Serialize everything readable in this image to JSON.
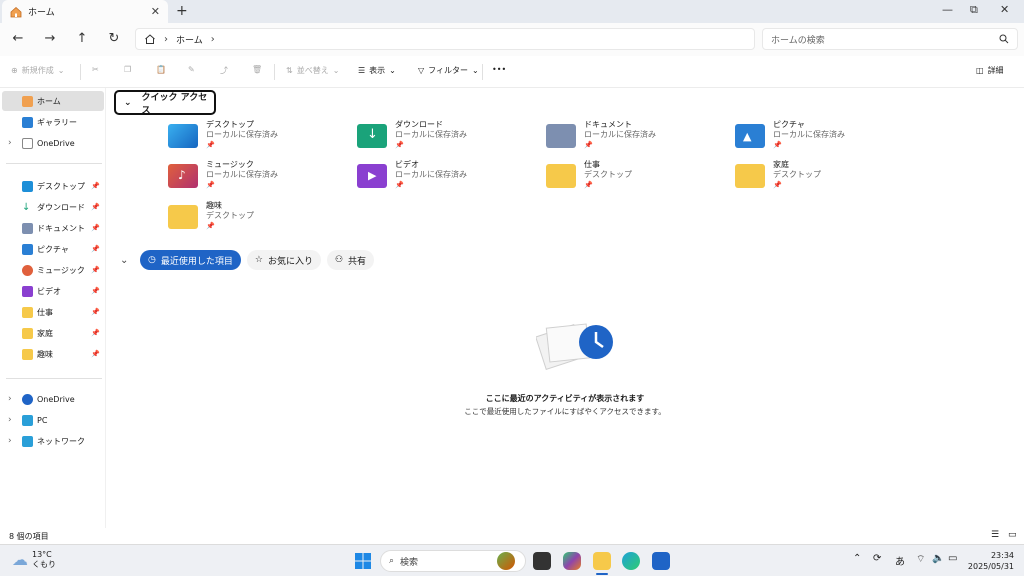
{
  "window": {
    "tab_title": "ホーム",
    "tab_close": "✕",
    "new_tab": "+",
    "controls": [
      "—",
      "⧉",
      "✕"
    ]
  },
  "address": {
    "crumb": "ホーム",
    "search_placeholder": "ホームの検索"
  },
  "toolbar": {
    "new_label": "新規作成",
    "sort_label": "並べ替え",
    "view_label": "表示",
    "filter_label": "フィルター",
    "more": "•••",
    "details_label": "詳細"
  },
  "sidebar": {
    "items": [
      {
        "label": "ホーム",
        "active": true
      },
      {
        "label": "ギャラリー"
      },
      {
        "label": "OneDrive"
      },
      {
        "label": "デスクトップ",
        "pinned": true
      },
      {
        "label": "ダウンロード",
        "pinned": true
      },
      {
        "label": "ドキュメント",
        "pinned": true
      },
      {
        "label": "ピクチャ",
        "pinned": true
      },
      {
        "label": "ミュージック",
        "pinned": true
      },
      {
        "label": "ビデオ",
        "pinned": true
      },
      {
        "label": "仕事",
        "pinned": true
      },
      {
        "label": "家庭",
        "pinned": true
      },
      {
        "label": "趣味",
        "pinned": true
      },
      {
        "label": "OneDrive"
      },
      {
        "label": "PC"
      },
      {
        "label": "ネットワーク"
      }
    ]
  },
  "quick_access": {
    "header": "クイック アクセス",
    "folders": [
      {
        "name": "デスクトップ",
        "location": "ローカルに保存済み",
        "color": "#1e8fd8"
      },
      {
        "name": "ダウンロード",
        "location": "ローカルに保存済み",
        "color": "#1aa37a"
      },
      {
        "name": "ドキュメント",
        "location": "ローカルに保存済み",
        "color": "#7d8fb0"
      },
      {
        "name": "ピクチャ",
        "location": "ローカルに保存済み",
        "color": "#2a7fd4"
      },
      {
        "name": "ミュージック",
        "location": "ローカルに保存済み",
        "color": "#e0603c"
      },
      {
        "name": "ビデオ",
        "location": "ローカルに保存済み",
        "color": "#8a3fd0"
      },
      {
        "name": "仕事",
        "location": "デスクトップ",
        "color": "#f6c94a"
      },
      {
        "name": "家庭",
        "location": "デスクトップ",
        "color": "#f6c94a"
      },
      {
        "name": "趣味",
        "location": "デスクトップ",
        "color": "#f6c94a"
      }
    ]
  },
  "recent": {
    "tabs": [
      "最近使用した項目",
      "お気に入り",
      "共有"
    ],
    "empty_title": "ここに最近のアクティビティが表示されます",
    "empty_sub": "ここで最近使用したファイルにすばやくアクセスできます。"
  },
  "status": {
    "item_count": "8 個の項目"
  },
  "taskbar": {
    "temperature": "13°C",
    "weather": "くもり",
    "search_label": "検索",
    "ime": "あ",
    "time": "23:34",
    "date": "2025/05/31"
  },
  "colors": {
    "accent": "#1f64c6",
    "folder_yellow": "#f6c94a"
  }
}
